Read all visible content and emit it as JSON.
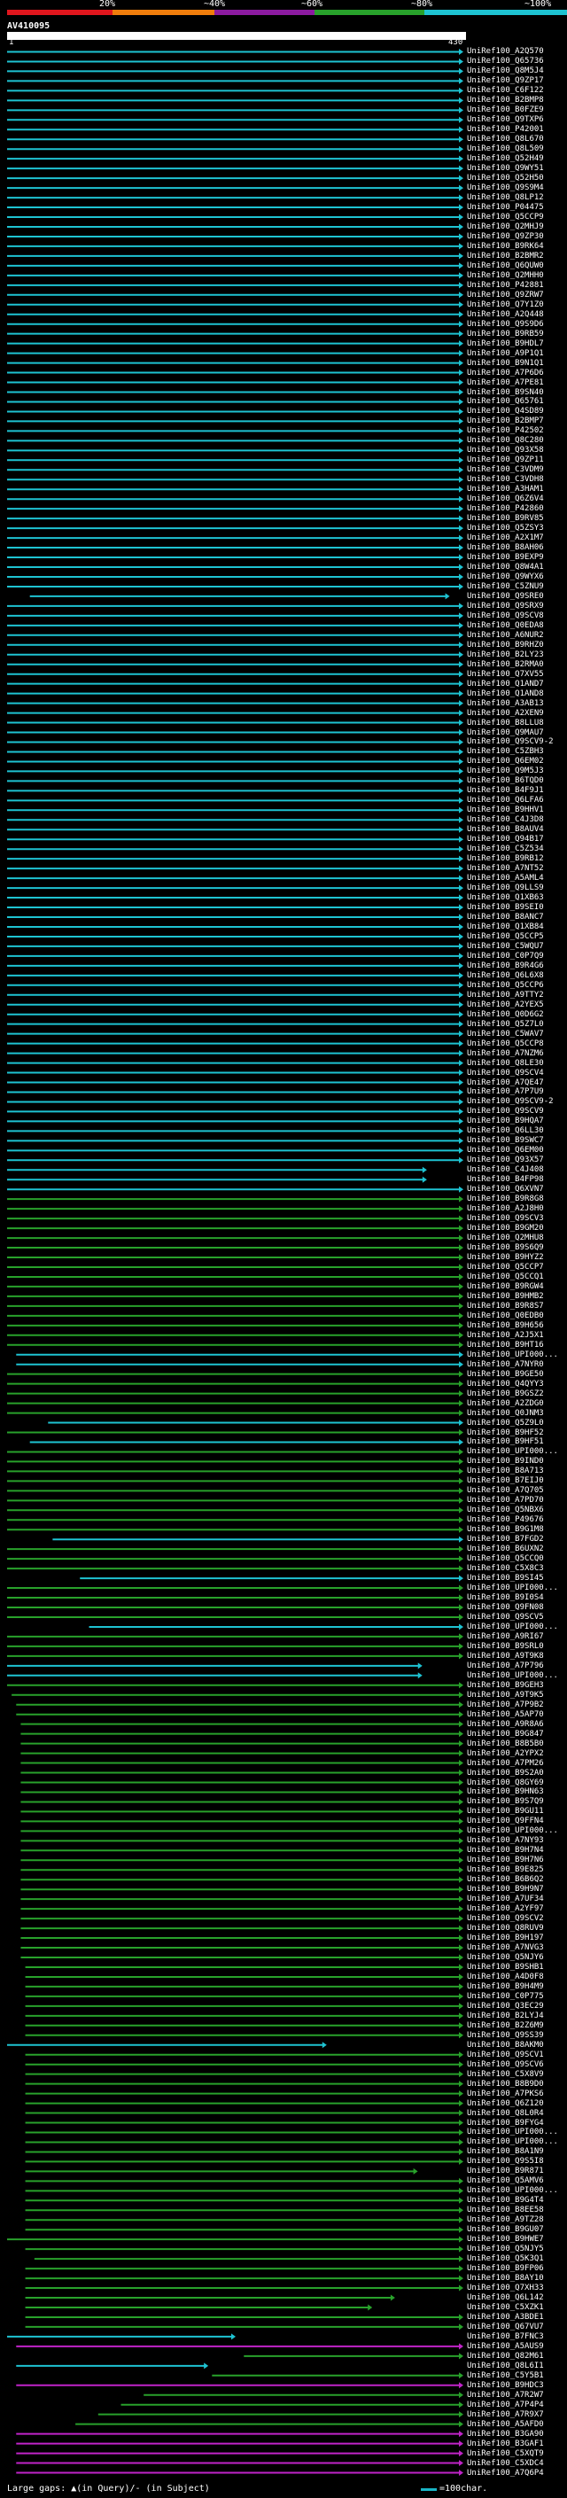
{
  "legend": {
    "labels": [
      "20%",
      "~40%",
      "~60%",
      "~80%",
      "~100%"
    ],
    "colors": [
      "#e0161d",
      "#f07d0c",
      "#8c1ba0",
      "#28a12b",
      "#1ec3d2"
    ]
  },
  "query": {
    "title": "AV410095",
    "ruler_start": "1",
    "ruler_end": "430"
  },
  "footer": {
    "left": "Large gaps: ▲(in Query)/- (in Subject)",
    "scale": "=100char."
  },
  "hits": [
    {
      "label": "UniRef100_A2Q570",
      "c": "cyan"
    },
    {
      "label": "UniRef100_Q65736",
      "c": "cyan"
    },
    {
      "label": "UniRef100_Q8M5J4",
      "c": "cyan"
    },
    {
      "label": "UniRef100_Q9ZP17",
      "c": "cyan"
    },
    {
      "label": "UniRef100_C6F122",
      "c": "cyan"
    },
    {
      "label": "UniRef100_B2BMP8",
      "c": "cyan"
    },
    {
      "label": "UniRef100_B0FZE9",
      "c": "cyan"
    },
    {
      "label": "UniRef100_Q9TXP6",
      "c": "cyan"
    },
    {
      "label": "UniRef100_P42001",
      "c": "cyan"
    },
    {
      "label": "UniRef100_Q8L670",
      "c": "cyan"
    },
    {
      "label": "UniRef100_Q8L509",
      "c": "cyan"
    },
    {
      "label": "UniRef100_Q52H49",
      "c": "cyan"
    },
    {
      "label": "UniRef100_Q9WY51",
      "c": "cyan"
    },
    {
      "label": "UniRef100_Q52H50",
      "c": "cyan"
    },
    {
      "label": "UniRef100_Q9S9M4",
      "c": "cyan"
    },
    {
      "label": "UniRef100_Q8LP12",
      "c": "cyan"
    },
    {
      "label": "UniRef100_P04475",
      "c": "cyan"
    },
    {
      "label": "UniRef100_Q5CCP9",
      "c": "cyan"
    },
    {
      "label": "UniRef100_Q2MHJ9",
      "c": "cyan"
    },
    {
      "label": "UniRef100_Q9ZP30",
      "c": "cyan"
    },
    {
      "label": "UniRef100_B9RK64",
      "c": "cyan"
    },
    {
      "label": "UniRef100_B2BMR2",
      "c": "cyan"
    },
    {
      "label": "UniRef100_Q6QUW0",
      "c": "cyan"
    },
    {
      "label": "UniRef100_Q2MHH0",
      "c": "cyan"
    },
    {
      "label": "UniRef100_P42881",
      "c": "cyan"
    },
    {
      "label": "UniRef100_Q9ZRW7",
      "c": "cyan"
    },
    {
      "label": "UniRef100_Q7Y1Z0",
      "c": "cyan"
    },
    {
      "label": "UniRef100_A2Q448",
      "c": "cyan"
    },
    {
      "label": "UniRef100_Q9S9D6",
      "c": "cyan"
    },
    {
      "label": "UniRef100_B9RB59",
      "c": "cyan"
    },
    {
      "label": "UniRef100_B9HDL7",
      "c": "cyan"
    },
    {
      "label": "UniRef100_A9P1Q1",
      "c": "cyan"
    },
    {
      "label": "UniRef100_B9N1Q1",
      "c": "cyan"
    },
    {
      "label": "UniRef100_A7P6D6",
      "c": "cyan"
    },
    {
      "label": "UniRef100_A7PE81",
      "c": "cyan"
    },
    {
      "label": "UniRef100_B9SN40",
      "c": "cyan"
    },
    {
      "label": "UniRef100_Q65761",
      "c": "cyan"
    },
    {
      "label": "UniRef100_Q4SD89",
      "c": "cyan"
    },
    {
      "label": "UniRef100_B2BMP7",
      "c": "cyan"
    },
    {
      "label": "UniRef100_P42502",
      "c": "cyan"
    },
    {
      "label": "UniRef100_Q8C280",
      "c": "cyan"
    },
    {
      "label": "UniRef100_Q93X58",
      "c": "cyan"
    },
    {
      "label": "UniRef100_Q9ZP11",
      "c": "cyan"
    },
    {
      "label": "UniRef100_C3VDM9",
      "c": "cyan"
    },
    {
      "label": "UniRef100_C3VDH8",
      "c": "cyan"
    },
    {
      "label": "UniRef100_A3HAM1",
      "c": "cyan"
    },
    {
      "label": "UniRef100_Q6Z6V4",
      "c": "cyan"
    },
    {
      "label": "UniRef100_P42860",
      "c": "cyan"
    },
    {
      "label": "UniRef100_B9RV85",
      "c": "cyan"
    },
    {
      "label": "UniRef100_Q5ZSY3",
      "c": "cyan"
    },
    {
      "label": "UniRef100_A2X1M7",
      "c": "cyan"
    },
    {
      "label": "UniRef100_B8AH06",
      "c": "cyan"
    },
    {
      "label": "UniRef100_B9EXP9",
      "c": "cyan"
    },
    {
      "label": "UniRef100_Q8W4A1",
      "c": "cyan"
    },
    {
      "label": "UniRef100_Q9WYX6",
      "c": "cyan"
    },
    {
      "label": "UniRef100_C5ZNU9",
      "c": "cyan"
    },
    {
      "label": "UniRef100_Q9SRE0",
      "c": "cyan",
      "s": 0.05,
      "e": 0.97
    },
    {
      "label": "UniRef100_Q9SRX9",
      "c": "cyan"
    },
    {
      "label": "UniRef100_Q9SCV8",
      "c": "cyan"
    },
    {
      "label": "UniRef100_Q0EDA8",
      "c": "cyan"
    },
    {
      "label": "UniRef100_A6NUR2",
      "c": "cyan"
    },
    {
      "label": "UniRef100_B9RHZ0",
      "c": "cyan"
    },
    {
      "label": "UniRef100_B2LY23",
      "c": "cyan"
    },
    {
      "label": "UniRef100_B2RMA0",
      "c": "cyan"
    },
    {
      "label": "UniRef100_Q7XV55",
      "c": "cyan"
    },
    {
      "label": "UniRef100_Q1AND7",
      "c": "cyan"
    },
    {
      "label": "UniRef100_Q1AND8",
      "c": "cyan"
    },
    {
      "label": "UniRef100_A3AB13",
      "c": "cyan"
    },
    {
      "label": "UniRef100_A2XEN9",
      "c": "cyan"
    },
    {
      "label": "UniRef100_B8LLU8",
      "c": "cyan"
    },
    {
      "label": "UniRef100_Q9MAU7",
      "c": "cyan"
    },
    {
      "label": "UniRef100_Q9SCV9-2",
      "c": "cyan"
    },
    {
      "label": "UniRef100_C5ZBH3",
      "c": "cyan"
    },
    {
      "label": "UniRef100_Q6EM02",
      "c": "cyan"
    },
    {
      "label": "UniRef100_Q9M5J3",
      "c": "cyan"
    },
    {
      "label": "UniRef100_B6TQD0",
      "c": "cyan"
    },
    {
      "label": "UniRef100_B4F9J1",
      "c": "cyan"
    },
    {
      "label": "UniRef100_Q6LFA6",
      "c": "cyan"
    },
    {
      "label": "UniRef100_B9HHV1",
      "c": "cyan"
    },
    {
      "label": "UniRef100_C4J3D8",
      "c": "cyan"
    },
    {
      "label": "UniRef100_B8AUV4",
      "c": "cyan"
    },
    {
      "label": "UniRef100_Q94B17",
      "c": "cyan"
    },
    {
      "label": "UniRef100_C5Z534",
      "c": "cyan"
    },
    {
      "label": "UniRef100_B9RB12",
      "c": "cyan"
    },
    {
      "label": "UniRef100_A7NT52",
      "c": "cyan"
    },
    {
      "label": "UniRef100_A5AML4",
      "c": "cyan"
    },
    {
      "label": "UniRef100_Q9LLS9",
      "c": "cyan"
    },
    {
      "label": "UniRef100_Q1XB63",
      "c": "cyan"
    },
    {
      "label": "UniRef100_B9SEI0",
      "c": "cyan"
    },
    {
      "label": "UniRef100_B8ANC7",
      "c": "cyan"
    },
    {
      "label": "UniRef100_Q1XB84",
      "c": "cyan"
    },
    {
      "label": "UniRef100_Q5CCP5",
      "c": "cyan"
    },
    {
      "label": "UniRef100_C5WQU7",
      "c": "cyan"
    },
    {
      "label": "UniRef100_C0P7Q9",
      "c": "cyan"
    },
    {
      "label": "UniRef100_B9R4G6",
      "c": "cyan"
    },
    {
      "label": "UniRef100_Q6L6X8",
      "c": "cyan"
    },
    {
      "label": "UniRef100_Q5CCP6",
      "c": "cyan"
    },
    {
      "label": "UniRef100_A9TTY2",
      "c": "cyan"
    },
    {
      "label": "UniRef100_A2YEX5",
      "c": "cyan"
    },
    {
      "label": "UniRef100_Q0D6G2",
      "c": "cyan"
    },
    {
      "label": "UniRef100_Q5Z7L0",
      "c": "cyan"
    },
    {
      "label": "UniRef100_C5WAV7",
      "c": "cyan"
    },
    {
      "label": "UniRef100_Q5CCP8",
      "c": "cyan"
    },
    {
      "label": "UniRef100_A7NZM6",
      "c": "cyan"
    },
    {
      "label": "UniRef100_Q8LE30",
      "c": "cyan"
    },
    {
      "label": "UniRef100_Q9SCV4",
      "c": "cyan"
    },
    {
      "label": "UniRef100_A7QE47",
      "c": "cyan"
    },
    {
      "label": "UniRef100_A7P7U9",
      "c": "cyan"
    },
    {
      "label": "UniRef100_Q9SCV9-2",
      "c": "cyan"
    },
    {
      "label": "UniRef100_Q9SCV9",
      "c": "cyan"
    },
    {
      "label": "UniRef100_B9HQA7",
      "c": "cyan"
    },
    {
      "label": "UniRef100_Q6LL30",
      "c": "cyan"
    },
    {
      "label": "UniRef100_B9SWC7",
      "c": "cyan"
    },
    {
      "label": "UniRef100_Q6EM00",
      "c": "cyan"
    },
    {
      "label": "UniRef100_Q93X57",
      "c": "cyan"
    },
    {
      "label": "UniRef100_C4J408",
      "c": "cyan",
      "s": 0,
      "e": 0.92
    },
    {
      "label": "UniRef100_B4FP98",
      "c": "cyan",
      "s": 0,
      "e": 0.92
    },
    {
      "label": "UniRef100_Q6XVN7",
      "c": "cyan"
    },
    {
      "label": "UniRef100_B9R8G8",
      "c": "green"
    },
    {
      "label": "UniRef100_A2J8H0",
      "c": "green"
    },
    {
      "label": "UniRef100_Q9SCV3",
      "c": "green"
    },
    {
      "label": "UniRef100_B9GM20",
      "c": "green"
    },
    {
      "label": "UniRef100_Q2MHU8",
      "c": "green"
    },
    {
      "label": "UniRef100_B9S6Q9",
      "c": "green"
    },
    {
      "label": "UniRef100_B9HYZ2",
      "c": "green"
    },
    {
      "label": "UniRef100_Q5CCP7",
      "c": "green"
    },
    {
      "label": "UniRef100_Q5CCQ1",
      "c": "green"
    },
    {
      "label": "UniRef100_B9RGW4",
      "c": "green"
    },
    {
      "label": "UniRef100_B9HMB2",
      "c": "green"
    },
    {
      "label": "UniRef100_B9R8S7",
      "c": "green"
    },
    {
      "label": "UniRef100_Q0EDB0",
      "c": "green"
    },
    {
      "label": "UniRef100_B9H656",
      "c": "green"
    },
    {
      "label": "UniRef100_A2J5X1",
      "c": "green"
    },
    {
      "label": "UniRef100_B9HT16",
      "c": "green"
    },
    {
      "label": "UniRef100_UPI000...",
      "c": "cyan",
      "s": 0.02,
      "e": 1
    },
    {
      "label": "UniRef100_A7NYR0",
      "c": "cyan",
      "s": 0.02,
      "e": 1
    },
    {
      "label": "UniRef100_B9GE50",
      "c": "green"
    },
    {
      "label": "UniRef100_Q4QYY3",
      "c": "green"
    },
    {
      "label": "UniRef100_B9GSZ2",
      "c": "green"
    },
    {
      "label": "UniRef100_A2ZDG0",
      "c": "green"
    },
    {
      "label": "UniRef100_Q0JNM3",
      "c": "green"
    },
    {
      "label": "UniRef100_Q5Z9L0",
      "c": "cyan",
      "s": 0.09,
      "e": 1
    },
    {
      "label": "UniRef100_B9HF52",
      "c": "green"
    },
    {
      "label": "UniRef100_B9HF51",
      "c": "cyan",
      "s": 0.05,
      "e": 1
    },
    {
      "label": "UniRef100_UPI000...",
      "c": "green"
    },
    {
      "label": "UniRef100_B9IND0",
      "c": "green"
    },
    {
      "label": "UniRef100_B8A713",
      "c": "green"
    },
    {
      "label": "UniRef100_B7EIJ0",
      "c": "green"
    },
    {
      "label": "UniRef100_A7Q705",
      "c": "green"
    },
    {
      "label": "UniRef100_A7PD70",
      "c": "green"
    },
    {
      "label": "UniRef100_Q5NBX6",
      "c": "green"
    },
    {
      "label": "UniRef100_P49676",
      "c": "green"
    },
    {
      "label": "UniRef100_B9G1M8",
      "c": "green"
    },
    {
      "label": "UniRef100_B7FGD2",
      "c": "cyan",
      "s": 0.1,
      "e": 1
    },
    {
      "label": "UniRef100_B6UXN2",
      "c": "green"
    },
    {
      "label": "UniRef100_Q5CCQ0",
      "c": "green"
    },
    {
      "label": "UniRef100_C5X8C3",
      "c": "green"
    },
    {
      "label": "UniRef100_B9SI45",
      "c": "cyan",
      "s": 0.16,
      "e": 1
    },
    {
      "label": "UniRef100_UPI000...",
      "c": "green"
    },
    {
      "label": "UniRef100_B9I0S4",
      "c": "green"
    },
    {
      "label": "UniRef100_Q9FN08",
      "c": "green"
    },
    {
      "label": "UniRef100_Q9SCV5",
      "c": "green"
    },
    {
      "label": "UniRef100_UPI000...",
      "c": "cyan",
      "s": 0.18,
      "e": 1
    },
    {
      "label": "UniRef100_A9RI67",
      "c": "green"
    },
    {
      "label": "UniRef100_B9SRL0",
      "c": "green"
    },
    {
      "label": "UniRef100_A9T9K8",
      "c": "green"
    },
    {
      "label": "UniRef100_A7P796",
      "c": "cyan",
      "s": 0,
      "e": 0.91
    },
    {
      "label": "UniRef100_UPI000...",
      "c": "cyan",
      "s": 0,
      "e": 0.91
    },
    {
      "label": "UniRef100_B9GEH3",
      "c": "green"
    },
    {
      "label": "UniRef100_A9T9K5",
      "c": "green",
      "s": 0.01,
      "e": 1
    },
    {
      "label": "UniRef100_A7P9B2",
      "c": "green",
      "s": 0.02,
      "e": 1
    },
    {
      "label": "UniRef100_A5AP70",
      "c": "green",
      "s": 0.02,
      "e": 1
    },
    {
      "label": "UniRef100_A9R8A6",
      "c": "green",
      "s": 0.03,
      "e": 1
    },
    {
      "label": "UniRef100_B9G847",
      "c": "green",
      "s": 0.03,
      "e": 1
    },
    {
      "label": "UniRef100_B8B5B0",
      "c": "green",
      "s": 0.03,
      "e": 1
    },
    {
      "label": "UniRef100_A2YPX2",
      "c": "green",
      "s": 0.03,
      "e": 1
    },
    {
      "label": "UniRef100_A7PM26",
      "c": "green",
      "s": 0.03,
      "e": 1
    },
    {
      "label": "UniRef100_B9S2A0",
      "c": "green",
      "s": 0.03,
      "e": 1
    },
    {
      "label": "UniRef100_Q8GY69",
      "c": "green",
      "s": 0.03,
      "e": 1
    },
    {
      "label": "UniRef100_B9HN63",
      "c": "green",
      "s": 0.03,
      "e": 1
    },
    {
      "label": "UniRef100_B9S7Q9",
      "c": "green",
      "s": 0.03,
      "e": 1
    },
    {
      "label": "UniRef100_B9GU11",
      "c": "green",
      "s": 0.03,
      "e": 1
    },
    {
      "label": "UniRef100_Q9FFN4",
      "c": "green",
      "s": 0.03,
      "e": 1
    },
    {
      "label": "UniRef100_UPI000...",
      "c": "green",
      "s": 0.03,
      "e": 1
    },
    {
      "label": "UniRef100_A7NY93",
      "c": "green",
      "s": 0.03,
      "e": 1
    },
    {
      "label": "UniRef100_B9H7N4",
      "c": "green",
      "s": 0.03,
      "e": 1
    },
    {
      "label": "UniRef100_B9H7N6",
      "c": "green",
      "s": 0.03,
      "e": 1
    },
    {
      "label": "UniRef100_B9E825",
      "c": "green",
      "s": 0.03,
      "e": 1
    },
    {
      "label": "UniRef100_B6B6Q2",
      "c": "green",
      "s": 0.03,
      "e": 1
    },
    {
      "label": "UniRef100_B9H9N7",
      "c": "green",
      "s": 0.03,
      "e": 1
    },
    {
      "label": "UniRef100_A7UF34",
      "c": "green",
      "s": 0.03,
      "e": 1
    },
    {
      "label": "UniRef100_A2YF97",
      "c": "green",
      "s": 0.03,
      "e": 1
    },
    {
      "label": "UniRef100_Q9SCV2",
      "c": "green",
      "s": 0.03,
      "e": 1
    },
    {
      "label": "UniRef100_Q8RUV9",
      "c": "green",
      "s": 0.03,
      "e": 1
    },
    {
      "label": "UniRef100_B9H197",
      "c": "green",
      "s": 0.03,
      "e": 1
    },
    {
      "label": "UniRef100_A7NVG3",
      "c": "green",
      "s": 0.03,
      "e": 1
    },
    {
      "label": "UniRef100_Q5NJY6",
      "c": "green",
      "s": 0.03,
      "e": 1
    },
    {
      "label": "UniRef100_B9SHB1",
      "c": "green",
      "s": 0.04,
      "e": 1
    },
    {
      "label": "UniRef100_A4D0F8",
      "c": "green",
      "s": 0.04,
      "e": 1
    },
    {
      "label": "UniRef100_B9H4M9",
      "c": "green",
      "s": 0.04,
      "e": 1
    },
    {
      "label": "UniRef100_C0P775",
      "c": "green",
      "s": 0.04,
      "e": 1
    },
    {
      "label": "UniRef100_Q3EC29",
      "c": "green",
      "s": 0.04,
      "e": 1
    },
    {
      "label": "UniRef100_B2LYJ4",
      "c": "green",
      "s": 0.04,
      "e": 1
    },
    {
      "label": "UniRef100_B2Z6M9",
      "c": "green",
      "s": 0.04,
      "e": 1
    },
    {
      "label": "UniRef100_Q9SS39",
      "c": "green",
      "s": 0.04,
      "e": 1
    },
    {
      "label": "UniRef100_B8AKM0",
      "c": "cyan",
      "s": 0,
      "e": 0.7
    },
    {
      "label": "UniRef100_Q9SCV1",
      "c": "green",
      "s": 0.04,
      "e": 1
    },
    {
      "label": "UniRef100_Q9SCV6",
      "c": "green",
      "s": 0.04,
      "e": 1
    },
    {
      "label": "UniRef100_C5X8V9",
      "c": "green",
      "s": 0.04,
      "e": 1
    },
    {
      "label": "UniRef100_B8B9D0",
      "c": "green",
      "s": 0.04,
      "e": 1
    },
    {
      "label": "UniRef100_A7PKS6",
      "c": "green",
      "s": 0.04,
      "e": 1
    },
    {
      "label": "UniRef100_Q6Z120",
      "c": "green",
      "s": 0.04,
      "e": 1
    },
    {
      "label": "UniRef100_Q8L0R4",
      "c": "green",
      "s": 0.04,
      "e": 1
    },
    {
      "label": "UniRef100_B9FYG4",
      "c": "green",
      "s": 0.04,
      "e": 1
    },
    {
      "label": "UniRef100_UPI000...",
      "c": "green",
      "s": 0.04,
      "e": 1
    },
    {
      "label": "UniRef100_UPI000...",
      "c": "green",
      "s": 0.04,
      "e": 1
    },
    {
      "label": "UniRef100_B8A1N9",
      "c": "green",
      "s": 0.04,
      "e": 1
    },
    {
      "label": "UniRef100_Q9S5I8",
      "c": "green",
      "s": 0.04,
      "e": 1
    },
    {
      "label": "UniRef100_B9R871",
      "c": "green",
      "s": 0.04,
      "e": 0.9
    },
    {
      "label": "UniRef100_Q5AMV6",
      "c": "green",
      "s": 0.04,
      "e": 1
    },
    {
      "label": "UniRef100_UPI000...",
      "c": "green",
      "s": 0.04,
      "e": 1
    },
    {
      "label": "UniRef100_B9G4T4",
      "c": "green",
      "s": 0.04,
      "e": 1
    },
    {
      "label": "UniRef100_B8EE58",
      "c": "green",
      "s": 0.04,
      "e": 1
    },
    {
      "label": "UniRef100_A9TZ28",
      "c": "green",
      "s": 0.04,
      "e": 1
    },
    {
      "label": "UniRef100_B9GU07",
      "c": "green",
      "s": 0.04,
      "e": 1
    },
    {
      "label": "UniRef100_B9HWE7",
      "c": "green",
      "s": 0,
      "e": 1
    },
    {
      "label": "UniRef100_Q5NJY5",
      "c": "green",
      "s": 0.04,
      "e": 1
    },
    {
      "label": "UniRef100_Q5K3Q1",
      "c": "green",
      "s": 0.06,
      "e": 1
    },
    {
      "label": "UniRef100_B9FP06",
      "c": "green",
      "s": 0.04,
      "e": 1
    },
    {
      "label": "UniRef100_B8AY10",
      "c": "green",
      "s": 0.04,
      "e": 1
    },
    {
      "label": "UniRef100_Q7XH33",
      "c": "green",
      "s": 0.04,
      "e": 1
    },
    {
      "label": "UniRef100_Q6L142",
      "c": "green",
      "s": 0.04,
      "e": 0.85
    },
    {
      "label": "UniRef100_C5XZK1",
      "c": "green",
      "s": 0.04,
      "e": 0.8
    },
    {
      "label": "UniRef100_A3BDE1",
      "c": "green",
      "s": 0.04,
      "e": 1
    },
    {
      "label": "UniRef100_Q67VU7",
      "c": "green",
      "s": 0.04,
      "e": 1
    },
    {
      "label": "UniRef100_B7FNC3",
      "c": "cyan",
      "s": 0,
      "e": 0.5
    },
    {
      "label": "UniRef100_A5AUS9",
      "c": "magenta",
      "s": 0.02,
      "e": 1
    },
    {
      "label": "UniRef100_Q82M61",
      "c": "green",
      "s": 0.52,
      "e": 1
    },
    {
      "label": "UniRef100_Q8L6I1",
      "c": "cyan",
      "s": 0.02,
      "e": 0.44
    },
    {
      "label": "UniRef100_C5Y5B1",
      "c": "green",
      "s": 0.45,
      "e": 1
    },
    {
      "label": "UniRef100_B9HDC3",
      "c": "magenta",
      "s": 0.02,
      "e": 1
    },
    {
      "label": "UniRef100_A7R2W7",
      "c": "green",
      "s": 0.3,
      "e": 1
    },
    {
      "label": "UniRef100_A7P4P4",
      "c": "green",
      "s": 0.25,
      "e": 1
    },
    {
      "label": "UniRef100_A7R9X7",
      "c": "green",
      "s": 0.2,
      "e": 1
    },
    {
      "label": "UniRef100_A5AFD0",
      "c": "green",
      "s": 0.15,
      "e": 1
    },
    {
      "label": "UniRef100_B3GA90",
      "c": "magenta",
      "s": 0.02,
      "e": 1
    },
    {
      "label": "UniRef100_B3GAF1",
      "c": "magenta",
      "s": 0.02,
      "e": 1
    },
    {
      "label": "UniRef100_C5XQT9",
      "c": "magenta",
      "s": 0.02,
      "e": 1
    },
    {
      "label": "UniRef100_C5XDC4",
      "c": "magenta",
      "s": 0.02,
      "e": 1
    },
    {
      "label": "UniRef100_A7Q6P4",
      "c": "magenta",
      "s": 0.02,
      "e": 1
    }
  ]
}
